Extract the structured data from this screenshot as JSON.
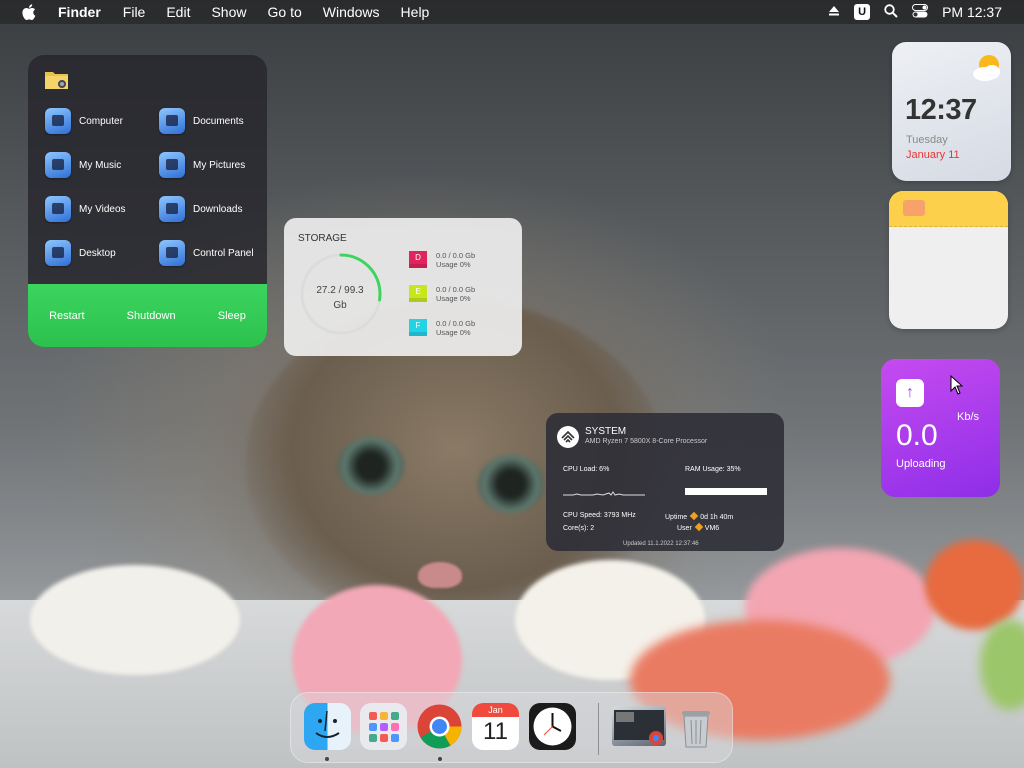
{
  "menubar": {
    "app_name": "Finder",
    "items": [
      "File",
      "Edit",
      "Show",
      "Go to",
      "Windows",
      "Help"
    ],
    "user_badge": "U",
    "clock": "PM 12:37",
    "icons": [
      "apple-icon",
      "eject-icon",
      "search-icon",
      "control-center-icon"
    ]
  },
  "quick_panel": {
    "items": [
      {
        "label": "Computer",
        "icon": "computer-icon"
      },
      {
        "label": "Documents",
        "icon": "documents-icon"
      },
      {
        "label": "My Music",
        "icon": "music-icon"
      },
      {
        "label": "My Pictures",
        "icon": "pictures-icon"
      },
      {
        "label": "My Videos",
        "icon": "videos-icon"
      },
      {
        "label": "Downloads",
        "icon": "downloads-icon"
      },
      {
        "label": "Desktop",
        "icon": "desktop-icon"
      },
      {
        "label": "Control Panel",
        "icon": "control-panel-icon"
      }
    ],
    "power": {
      "restart": "Restart",
      "shutdown": "Shutdown",
      "sleep": "Sleep"
    },
    "accent": "#33cc55"
  },
  "storage": {
    "title": "STORAGE",
    "used": "27.2 / 99.3",
    "unit": "Gb",
    "used_fraction": 0.274,
    "drives": [
      {
        "letter": "D",
        "size": "0.0 / 0.0 Gb",
        "usage": "Usage 0%",
        "color": "#e0245e"
      },
      {
        "letter": "E",
        "size": "0.0 / 0.0 Gb",
        "usage": "Usage 0%",
        "color": "#c8e61e"
      },
      {
        "letter": "F",
        "size": "0.0 / 0.0 Gb",
        "usage": "Usage 0%",
        "color": "#22d3e6"
      }
    ]
  },
  "system": {
    "title": "SYSTEM",
    "cpu_name": "AMD Ryzen 7 5800X 8-Core Processor",
    "cpu_load": "CPU Load: 6%",
    "ram_usage": "RAM Usage: 35%",
    "cpu_speed": "CPU Speed: 3793 MHz",
    "cores": "Core(s): 2",
    "uptime_label": "Uptime",
    "uptime_value": "0d 1h 40m",
    "user_label": "User",
    "user_value": "VM6",
    "updated": "Updated 11.1.2022 12:37:46"
  },
  "clock_widget": {
    "time": "12:37",
    "day": "Tuesday",
    "date": "January 11",
    "weather_icon": "partly-cloudy-icon"
  },
  "network_widget": {
    "speed": "0.0",
    "unit": "Kb/s",
    "label": "Uploading",
    "color": "#a93ff0"
  },
  "dock": {
    "apps": [
      "finder-icon",
      "launchpad-icon",
      "chrome-icon",
      "calendar-icon",
      "clock-icon"
    ],
    "calendar_month": "Jan",
    "calendar_day": "11",
    "trash_icon": "trash-icon"
  }
}
